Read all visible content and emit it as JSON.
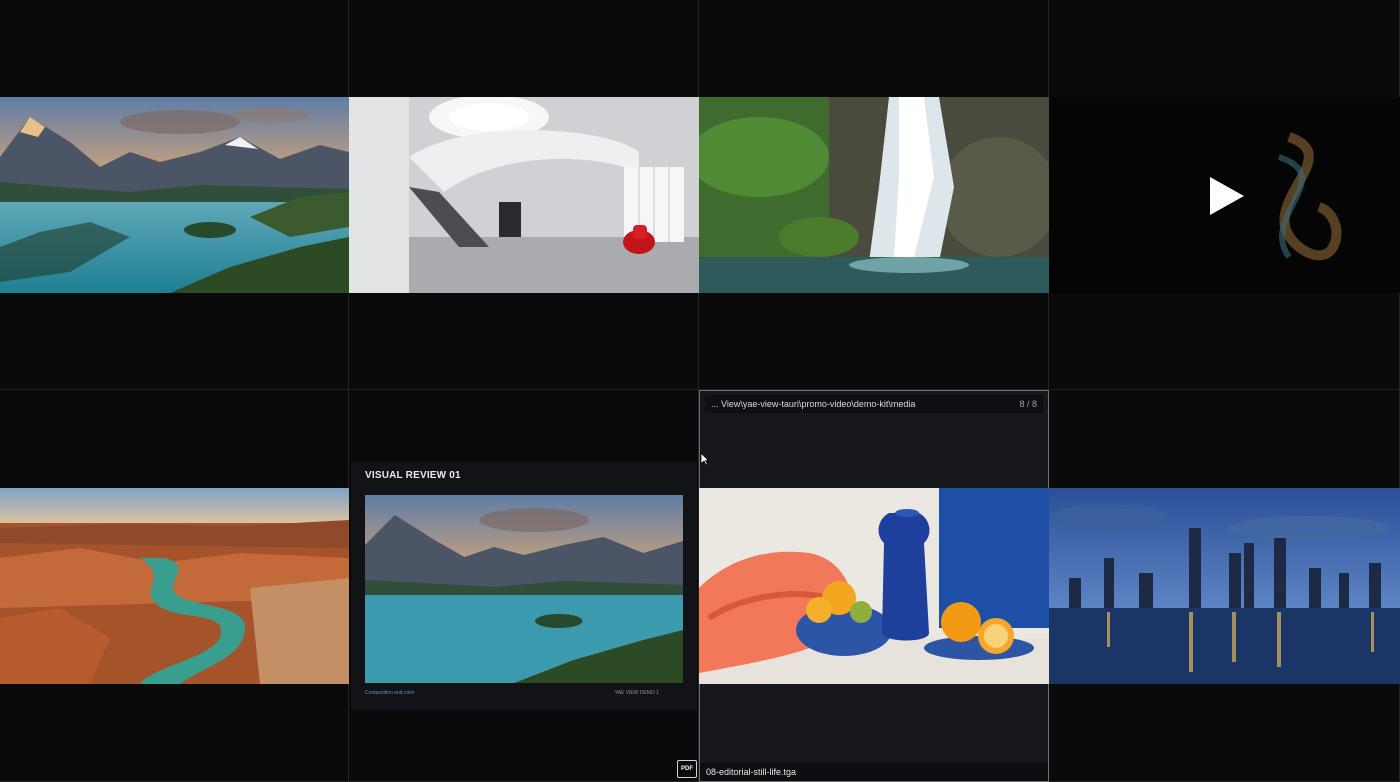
{
  "gallery": {
    "items": [
      {
        "id": "mountain-lake",
        "icon": "mountain-lake-thumbnail"
      },
      {
        "id": "spiral-staircase",
        "icon": "interior-staircase-thumbnail"
      },
      {
        "id": "waterfall",
        "icon": "waterfall-thumbnail"
      },
      {
        "id": "video",
        "icon": "play-icon"
      },
      {
        "id": "canyon-river",
        "icon": "canyon-river-thumbnail"
      },
      {
        "id": "pdf",
        "icon": "pdf-document-thumbnail"
      },
      {
        "id": "still-life",
        "icon": "still-life-thumbnail"
      },
      {
        "id": "city-skyline",
        "icon": "city-skyline-thumbnail"
      }
    ],
    "active": {
      "path": "... View\\yae-view-tauri\\promo-video\\demo-kit\\media",
      "counter": "8 / 8",
      "filename": "08-editorial-still-life.tga"
    },
    "pdf": {
      "title": "VISUAL REVIEW 01",
      "caption": "Composition and color",
      "footer": "YAE VIEW DEMO",
      "page_marker": "1",
      "badge": "PDF"
    }
  }
}
